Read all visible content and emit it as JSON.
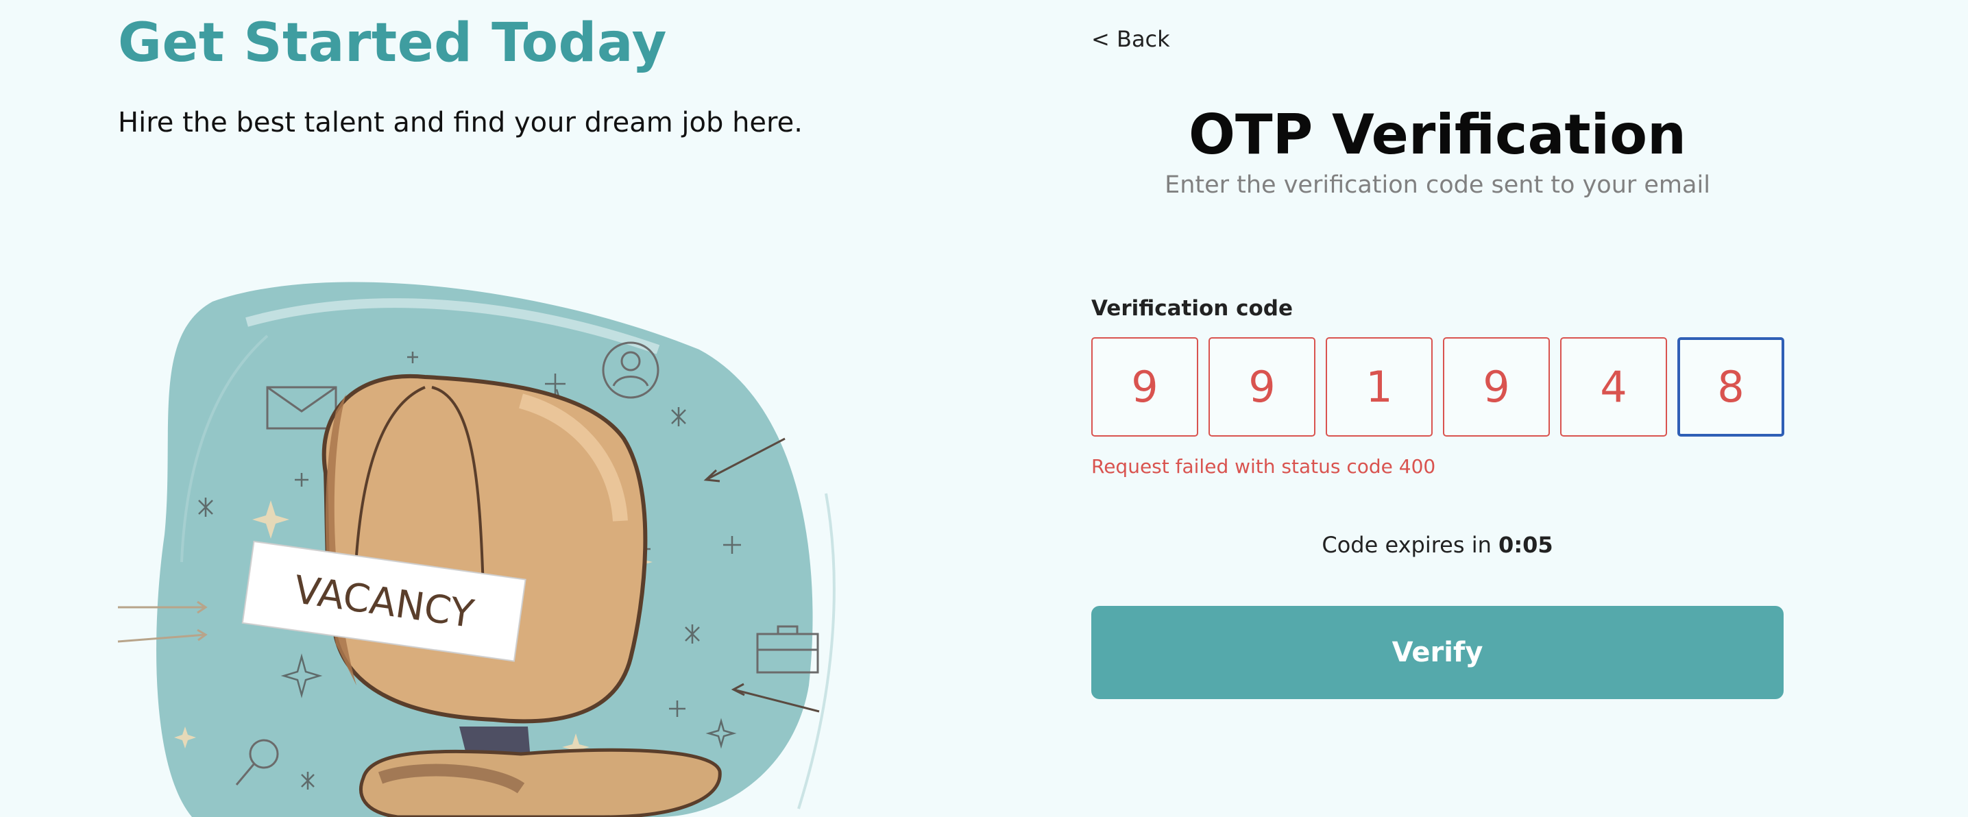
{
  "hero": {
    "title": "Get Started Today",
    "subtitle": "Hire the best talent and find your dream job here.",
    "illustration_sign": "VACANCY"
  },
  "nav": {
    "back_label": "< Back"
  },
  "otp": {
    "title": "OTP Verification",
    "subtitle": "Enter the verification code sent to your email",
    "code_label": "Verification code",
    "digits": [
      "9",
      "9",
      "1",
      "9",
      "4",
      "8"
    ],
    "error": "Request failed with status code 400",
    "expiry_prefix": "Code expires in",
    "expiry_time": "0:05",
    "verify_label": "Verify"
  },
  "colors": {
    "brand_teal": "#3f9da0",
    "button_teal": "#55a9ab",
    "error_red": "#d9534f",
    "focus_blue": "#2f5fb6",
    "background": "#f2fbfc"
  }
}
